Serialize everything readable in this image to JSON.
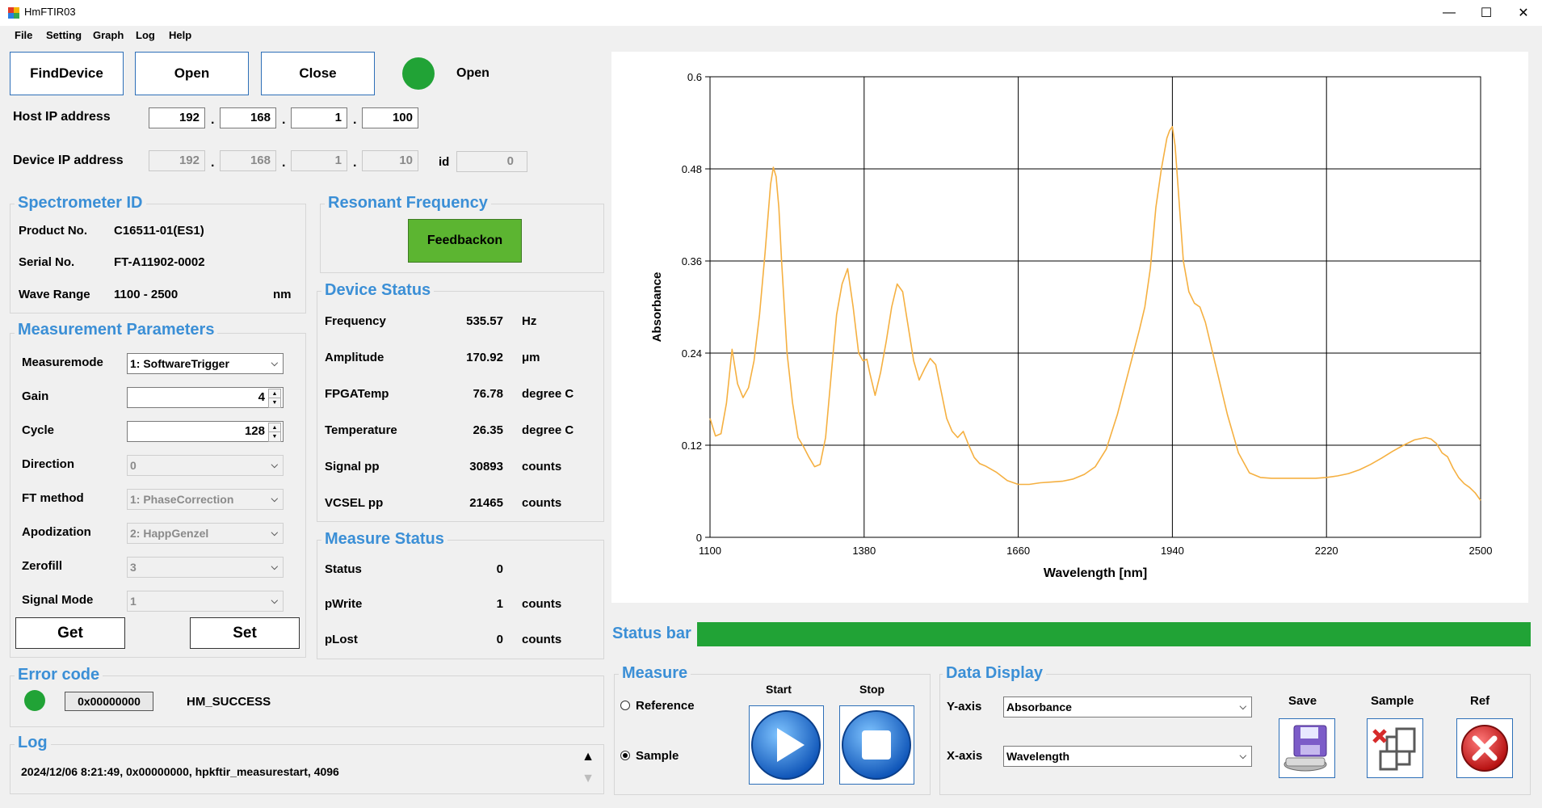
{
  "window": {
    "title": "HmFTIR03",
    "minimize": "—",
    "maximize": "☐",
    "close": "✕"
  },
  "menu": [
    "File",
    "Setting",
    "Graph",
    "Log",
    "Help"
  ],
  "connection": {
    "find_device": "FindDevice",
    "open": "Open",
    "close": "Close",
    "status_text": "Open",
    "status_color": "#21a336"
  },
  "host_ip": {
    "label": "Host IP address",
    "octets": [
      "192",
      "168",
      "1",
      "100"
    ]
  },
  "device_ip": {
    "label": "Device IP address",
    "octets": [
      "192",
      "168",
      "1",
      "10"
    ],
    "id_label": "id",
    "id_value": "0"
  },
  "spectrometer": {
    "title": "Spectrometer ID",
    "product_label": "Product No.",
    "product_value": "C16511-01(ES1)",
    "serial_label": "Serial No.",
    "serial_value": "FT-A11902-0002",
    "wave_label": "Wave Range",
    "wave_value": "1100 - 2500",
    "wave_unit": "nm"
  },
  "resonant": {
    "title": "Resonant Frequency",
    "button": "Feedbackon",
    "button_color": "#5cb531"
  },
  "params": {
    "title": "Measurement Parameters",
    "rows": [
      {
        "label": "Measuremode",
        "value": "1: SoftwareTrigger",
        "kind": "combo"
      },
      {
        "label": "Gain",
        "value": "4",
        "kind": "spin"
      },
      {
        "label": "Cycle",
        "value": "128",
        "kind": "spin"
      },
      {
        "label": "Direction",
        "value": "0",
        "kind": "combo-disabled"
      },
      {
        "label": "FT method",
        "value": "1: PhaseCorrection",
        "kind": "combo-disabled"
      },
      {
        "label": "Apodization",
        "value": "2: HappGenzel",
        "kind": "combo-disabled"
      },
      {
        "label": "Zerofill",
        "value": "3",
        "kind": "combo-disabled"
      },
      {
        "label": "Signal Mode",
        "value": "1",
        "kind": "combo-disabled"
      }
    ],
    "get": "Get",
    "set": "Set"
  },
  "device_status": {
    "title": "Device Status",
    "rows": [
      {
        "label": "Frequency",
        "value": "535.57",
        "unit": "Hz"
      },
      {
        "label": "Amplitude",
        "value": "170.92",
        "unit": "μm"
      },
      {
        "label": "FPGATemp",
        "value": "76.78",
        "unit": "degree C"
      },
      {
        "label": "Temperature",
        "value": "26.35",
        "unit": "degree C"
      },
      {
        "label": "Signal pp",
        "value": "30893",
        "unit": "counts"
      },
      {
        "label": "VCSEL pp",
        "value": "21465",
        "unit": "counts"
      }
    ]
  },
  "measure_status": {
    "title": "Measure Status",
    "rows": [
      {
        "label": "Status",
        "value": "0",
        "unit": ""
      },
      {
        "label": "pWrite",
        "value": "1",
        "unit": "counts"
      },
      {
        "label": "pLost",
        "value": "0",
        "unit": "counts"
      }
    ]
  },
  "error": {
    "title": "Error code",
    "code": "0x00000000",
    "message": "HM_SUCCESS",
    "color": "#21a336"
  },
  "log": {
    "title": "Log",
    "entry": "2024/12/06 8:21:49, 0x00000000, hpkftir_measurestart, 4096"
  },
  "status_bar": {
    "label": "Status bar",
    "progress": 1.0,
    "color": "#21a336"
  },
  "measure": {
    "title": "Measure",
    "reference": "Reference",
    "sample": "Sample",
    "selected": "Sample",
    "start": "Start",
    "stop": "Stop"
  },
  "data_display": {
    "title": "Data Display",
    "y_label": "Y-axis",
    "y_value": "Absorbance",
    "x_label": "X-axis",
    "x_value": "Wavelength",
    "save": "Save",
    "sample": "Sample",
    "ref": "Ref"
  },
  "chart_data": {
    "type": "line",
    "xlabel": "Wavelength [nm]",
    "ylabel": "Absorbance",
    "xlim": [
      1100,
      2500
    ],
    "ylim": [
      0,
      0.6
    ],
    "xticks": [
      "1100",
      "1380",
      "1660",
      "1940",
      "2220",
      "2500"
    ],
    "yticks": [
      "0",
      "0.12",
      "0.24",
      "0.36",
      "0.48",
      "0.6"
    ],
    "grid": true,
    "line_color": "#f5b041",
    "x": [
      1100,
      1110,
      1120,
      1130,
      1140,
      1150,
      1160,
      1170,
      1180,
      1190,
      1200,
      1210,
      1215,
      1220,
      1225,
      1230,
      1240,
      1250,
      1260,
      1270,
      1280,
      1290,
      1300,
      1310,
      1320,
      1330,
      1340,
      1350,
      1360,
      1370,
      1378,
      1385,
      1390,
      1400,
      1410,
      1420,
      1430,
      1440,
      1450,
      1460,
      1470,
      1480,
      1490,
      1500,
      1510,
      1520,
      1530,
      1540,
      1550,
      1560,
      1570,
      1580,
      1590,
      1600,
      1620,
      1640,
      1660,
      1680,
      1700,
      1720,
      1740,
      1760,
      1780,
      1800,
      1820,
      1840,
      1860,
      1880,
      1890,
      1900,
      1910,
      1920,
      1930,
      1935,
      1940,
      1945,
      1950,
      1960,
      1970,
      1980,
      1990,
      2000,
      2020,
      2040,
      2060,
      2080,
      2100,
      2120,
      2140,
      2160,
      2180,
      2200,
      2220,
      2240,
      2260,
      2280,
      2300,
      2320,
      2340,
      2360,
      2380,
      2400,
      2410,
      2420,
      2430,
      2440,
      2450,
      2460,
      2470,
      2480,
      2490,
      2500
    ],
    "y": [
      0.155,
      0.132,
      0.135,
      0.175,
      0.245,
      0.2,
      0.182,
      0.195,
      0.23,
      0.29,
      0.37,
      0.46,
      0.482,
      0.47,
      0.43,
      0.36,
      0.24,
      0.175,
      0.13,
      0.118,
      0.104,
      0.092,
      0.095,
      0.13,
      0.21,
      0.29,
      0.33,
      0.35,
      0.3,
      0.24,
      0.23,
      0.232,
      0.215,
      0.185,
      0.215,
      0.255,
      0.3,
      0.33,
      0.32,
      0.275,
      0.23,
      0.205,
      0.22,
      0.233,
      0.225,
      0.19,
      0.155,
      0.138,
      0.13,
      0.138,
      0.12,
      0.104,
      0.096,
      0.093,
      0.085,
      0.074,
      0.069,
      0.069,
      0.071,
      0.072,
      0.073,
      0.076,
      0.082,
      0.092,
      0.115,
      0.16,
      0.215,
      0.27,
      0.3,
      0.35,
      0.43,
      0.48,
      0.52,
      0.53,
      0.535,
      0.51,
      0.46,
      0.36,
      0.32,
      0.305,
      0.3,
      0.28,
      0.22,
      0.16,
      0.11,
      0.084,
      0.078,
      0.077,
      0.077,
      0.077,
      0.077,
      0.077,
      0.078,
      0.08,
      0.083,
      0.088,
      0.095,
      0.103,
      0.112,
      0.12,
      0.127,
      0.13,
      0.128,
      0.122,
      0.11,
      0.105,
      0.09,
      0.078,
      0.07,
      0.065,
      0.058,
      0.048
    ]
  }
}
